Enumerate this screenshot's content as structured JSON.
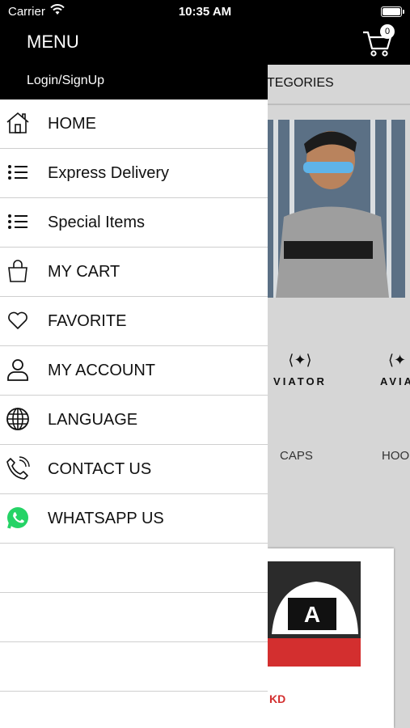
{
  "status_bar": {
    "carrier": "Carrier",
    "time": "10:35 AM"
  },
  "header": {
    "cart_count": "0"
  },
  "drawer": {
    "title": "MENU",
    "login": "Login/SignUp",
    "items": [
      {
        "label": "HOME",
        "icon": "home-icon"
      },
      {
        "label": "Express Delivery",
        "icon": "list-icon"
      },
      {
        "label": "Special Items",
        "icon": "list-icon"
      },
      {
        "label": "MY CART",
        "icon": "shopping-bag-icon"
      },
      {
        "label": "FAVORITE",
        "icon": "heart-icon"
      },
      {
        "label": "MY ACCOUNT",
        "icon": "user-icon"
      },
      {
        "label": "LANGUAGE",
        "icon": "globe-icon"
      },
      {
        "label": "CONTACT US",
        "icon": "phone-icon"
      },
      {
        "label": "WHATSAPP US",
        "icon": "whatsapp-icon"
      }
    ]
  },
  "background": {
    "categories_tab": "TEGORIES",
    "logo_text_1": "VIATOR",
    "logo_text_2": "AVIA",
    "label_caps": "CAPS",
    "label_hoodies": "HOO",
    "price_suffix": "KD"
  },
  "colors": {
    "accent": "#000000",
    "whatsapp": "#25D366",
    "price": "#d32f2f"
  }
}
